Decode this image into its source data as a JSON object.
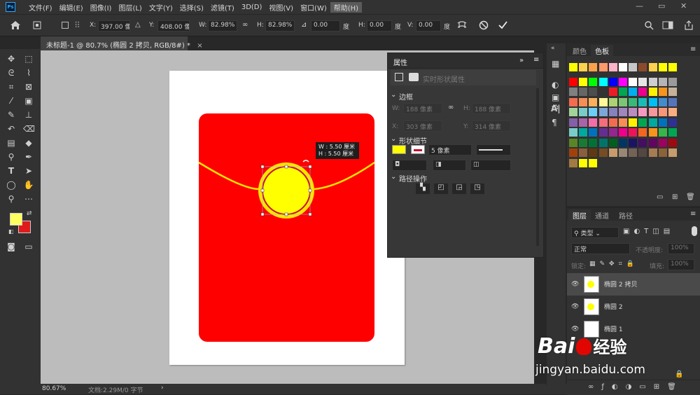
{
  "menubar": {
    "app_icon": "Ps",
    "items": [
      "文件(F)",
      "编辑(E)",
      "图像(I)",
      "图层(L)",
      "文字(Y)",
      "选择(S)",
      "滤镜(T)",
      "3D(D)",
      "视图(V)",
      "窗口(W)",
      "帮助(H)"
    ],
    "controls": [
      "—",
      "▭",
      "✕"
    ]
  },
  "options": {
    "x_label": "X:",
    "x_value": "397.00 像素",
    "y_label": "Y:",
    "y_value": "408.00 像素",
    "w_label": "W:",
    "w_value": "82.98%",
    "h_label": "H:",
    "h_value": "82.98%",
    "angle_value": "0.00",
    "angle_unit": "度",
    "hskew_label": "H:",
    "hskew_value": "0.00",
    "hskew_unit": "度",
    "vskew_label": "V:",
    "vskew_value": "0.00",
    "vskew_unit": "度"
  },
  "document": {
    "tab_title": "未标题-1 @ 80.7% (椭圆 2 拷贝, RGB/8#) *",
    "close": "×"
  },
  "canvas": {
    "tooltip_w": "W : 5.50 厘米",
    "tooltip_h": "H : 5.50 厘米",
    "envelope_color": "#ff0000",
    "circle_color": "#ffff00"
  },
  "status": {
    "zoom": "80.67%",
    "doc_info": "文档:2.29M/0 字节"
  },
  "properties": {
    "title": "属性",
    "subtitle": "实时形状属性",
    "border_section": "边框",
    "w_label": "W:",
    "w_value": "188 像素",
    "h_label": "H:",
    "h_value": "188 像素",
    "x_label": "X:",
    "x_value": "303 像素",
    "y_label": "Y:",
    "y_value": "314 像素",
    "shape_section": "形状细节",
    "stroke_width": "5 像素",
    "path_section": "路径操作"
  },
  "swatches": {
    "tab_color": "颜色",
    "tab_swatches": "色板"
  },
  "layers": {
    "tab_layers": "图层",
    "tab_channels": "通道",
    "tab_paths": "路径",
    "kind_filter": "类型",
    "blend_mode": "正常",
    "opacity_label": "不透明度:",
    "opacity_value": "100%",
    "lock_label": "锁定:",
    "fill_label": "填充:",
    "fill_value": "100%",
    "items": [
      "椭圆 2 拷贝",
      "椭圆 2",
      "椭圆 1"
    ]
  },
  "watermark": {
    "brand": "Bai",
    "brand_suffix": "经验",
    "url": "jingyan.baidu.com"
  }
}
